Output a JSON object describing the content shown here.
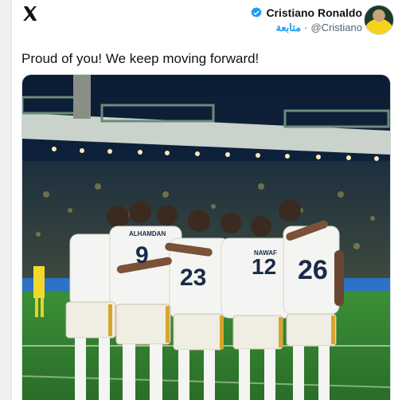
{
  "author": {
    "name": "Cristiano Ronaldo",
    "follow_label": "متابعة",
    "handle": "@Cristiano"
  },
  "tweet": {
    "text": "Proud of you! We keep moving forward!"
  },
  "media": {
    "jersey_numbers": [
      "9",
      "23",
      "12",
      "26"
    ],
    "jersey_names": [
      "ALHAMDAN",
      "NAWAF"
    ]
  },
  "colors": {
    "verified": "#1d9bf0",
    "pitch": "#2f7d2e",
    "kit": "#f4f4f2"
  },
  "icons": {
    "logo": "x-logo-icon",
    "verified": "verified-badge-icon"
  }
}
